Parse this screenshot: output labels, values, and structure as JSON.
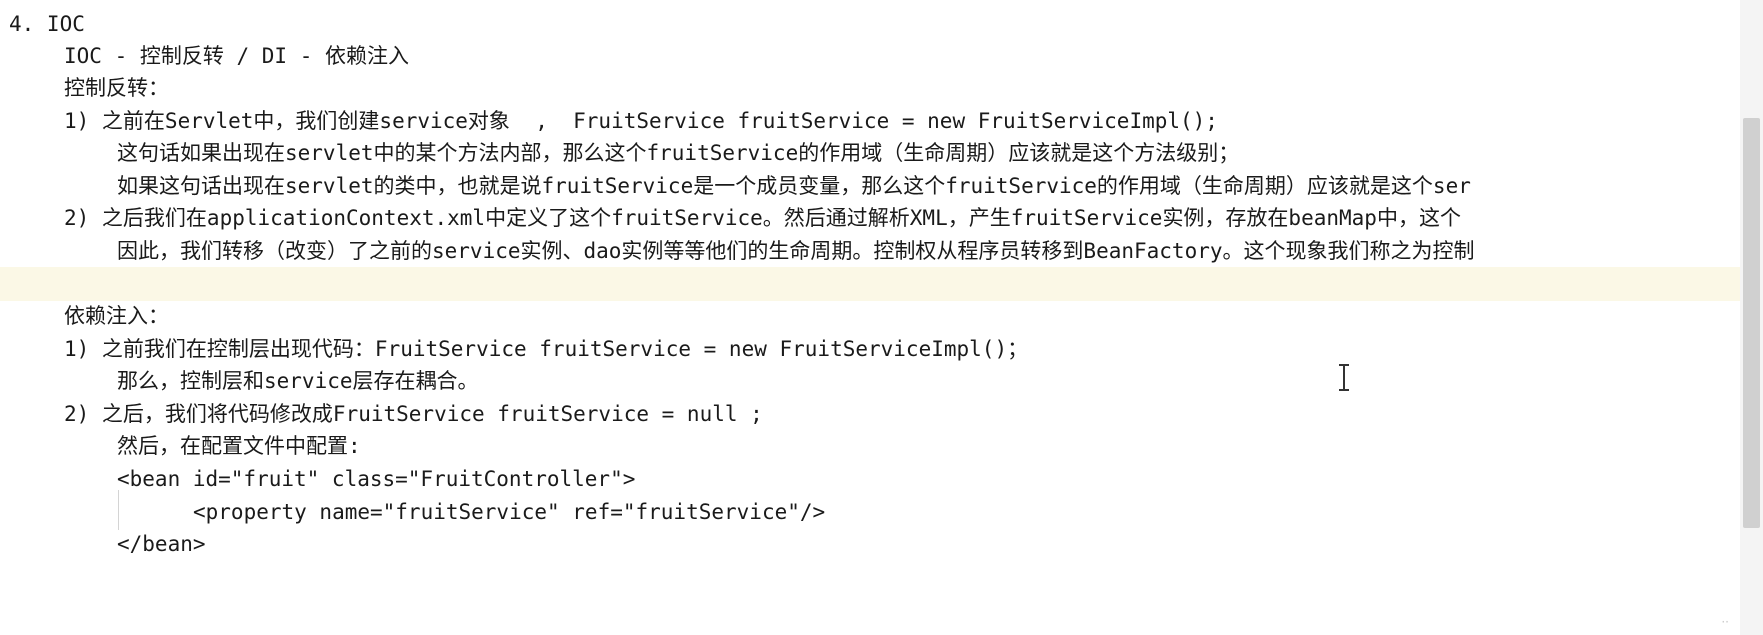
{
  "document": {
    "lines": [
      {
        "text": "4. IOC"
      },
      {
        "text": "IOC - 控制反转 / DI - 依赖注入"
      },
      {
        "text": "控制反转："
      },
      {
        "text": "1) 之前在Servlet中，我们创建service对象  ,  FruitService fruitService = new FruitServiceImpl();"
      },
      {
        "text": "这句话如果出现在servlet中的某个方法内部，那么这个fruitService的作用域（生命周期）应该就是这个方法级别；"
      },
      {
        "text": "如果这句话出现在servlet的类中，也就是说fruitService是一个成员变量，那么这个fruitService的作用域（生命周期）应该就是这个ser"
      },
      {
        "text": "2) 之后我们在applicationContext.xml中定义了这个fruitService。然后通过解析XML，产生fruitService实例，存放在beanMap中，这个"
      },
      {
        "text": "因此，我们转移（改变）了之前的service实例、dao实例等等他们的生命周期。控制权从程序员转移到BeanFactory。这个现象我们称之为控制"
      },
      {
        "text": ""
      },
      {
        "text": "依赖注入："
      },
      {
        "text": "1) 之前我们在控制层出现代码：FruitService fruitService = new FruitServiceImpl()；"
      },
      {
        "text": "那么，控制层和service层存在耦合。"
      },
      {
        "text": "2) 之后，我们将代码修改成FruitService fruitService = null ;"
      },
      {
        "text": "然后，在配置文件中配置:"
      },
      {
        "text": "<bean id=\"fruit\" class=\"FruitController\">"
      },
      {
        "text": "<property name=\"fruitService\" ref=\"fruitService\"/>"
      },
      {
        "text": "</bean>"
      }
    ]
  },
  "corner_mark": "··"
}
